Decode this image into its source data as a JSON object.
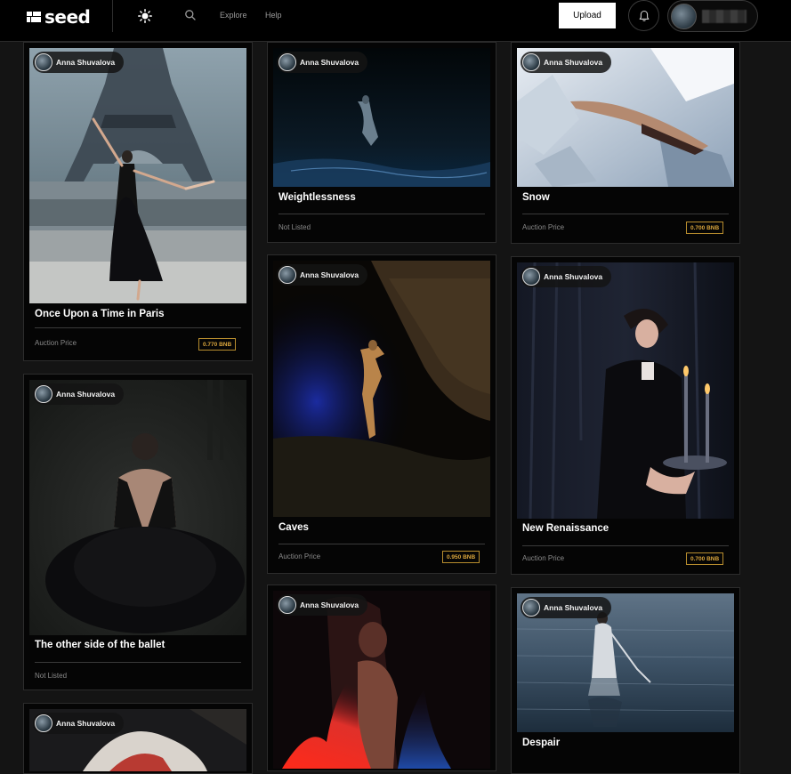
{
  "header": {
    "logo_text": "seed",
    "theme_icon": "sun-icon",
    "search_icon": "search-icon",
    "nav": [
      {
        "label": "Explore"
      },
      {
        "label": "Help"
      }
    ],
    "upload_label": "Upload",
    "bell_icon": "bell-icon"
  },
  "cards": [
    {
      "creator": "Anna Shuvalova",
      "title": "Once Upon a Time in Paris",
      "status": "Auction Price",
      "price": "0.770 BNB"
    },
    {
      "creator": "Anna Shuvalova",
      "title": "The other side of the ballet",
      "status": "Not Listed",
      "price": ""
    },
    {
      "creator": "Anna Shuvalova",
      "title": "",
      "status": "",
      "price": ""
    },
    {
      "creator": "Anna Shuvalova",
      "title": "Weightlessness",
      "status": "Not Listed",
      "price": ""
    },
    {
      "creator": "Anna Shuvalova",
      "title": "Caves",
      "status": "Auction Price",
      "price": "0.950 BNB"
    },
    {
      "creator": "Anna Shuvalova",
      "title": "",
      "status": "",
      "price": ""
    },
    {
      "creator": "Anna Shuvalova",
      "title": "Snow",
      "status": "Auction Price",
      "price": "0.700 BNB"
    },
    {
      "creator": "Anna Shuvalova",
      "title": "New Renaissance",
      "status": "Auction Price",
      "price": "0.700 BNB"
    },
    {
      "creator": "Anna Shuvalova",
      "title": "Despair",
      "status": "",
      "price": ""
    }
  ],
  "colors": {
    "background": "#141414",
    "header": "#000000",
    "card": "#050505",
    "price_accent": "#d9a53c"
  }
}
